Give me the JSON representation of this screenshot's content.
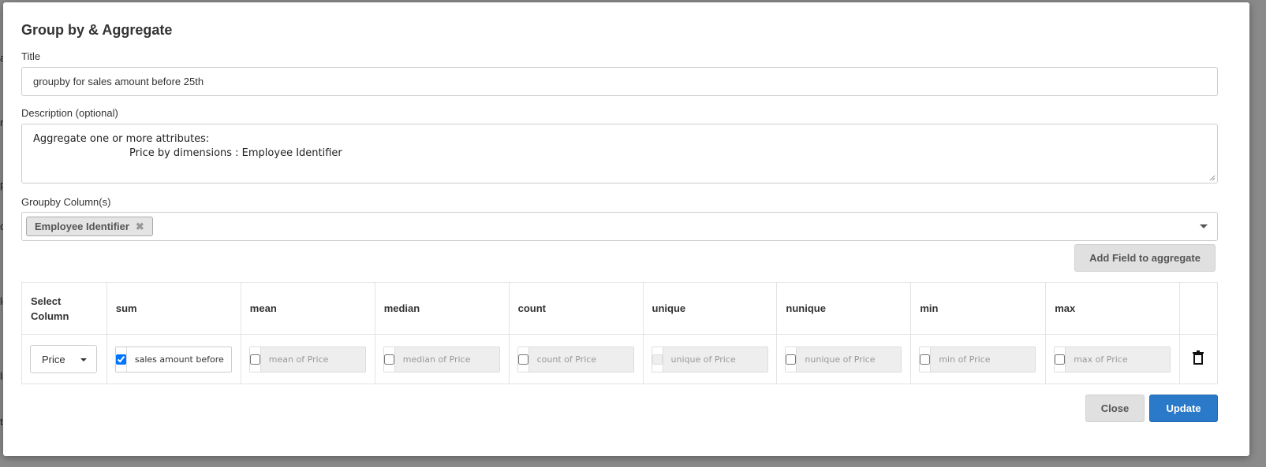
{
  "modal": {
    "title": "Group by & Aggregate",
    "title_label": "Title",
    "title_value": "groupby for sales amount before 25th",
    "description_label": "Description (optional)",
    "description_line1": "Aggregate one or more attributes:",
    "description_line2": "Price by dimensions : Employee Identifier",
    "groupby_label": "Groupby Column(s)",
    "groupby_chips": [
      "Employee Identifier"
    ],
    "add_field_label": "Add Field to aggregate",
    "close_label": "Close",
    "update_label": "Update"
  },
  "table": {
    "headers": [
      "Select Column",
      "sum",
      "mean",
      "median",
      "count",
      "unique",
      "nunique",
      "min",
      "max"
    ],
    "row": {
      "column": "Price",
      "sum": {
        "checked": true,
        "value": "sales amount before"
      },
      "mean": {
        "checked": false,
        "placeholder": "mean of Price"
      },
      "median": {
        "checked": false,
        "placeholder": "median of Price"
      },
      "count": {
        "checked": false,
        "placeholder": "count of Price"
      },
      "unique": {
        "checked": false,
        "disabled": true,
        "placeholder": "unique of Price"
      },
      "nunique": {
        "checked": false,
        "placeholder": "nunique of Price"
      },
      "min": {
        "checked": false,
        "placeholder": "min of Price"
      },
      "max": {
        "checked": false,
        "placeholder": "max of Price"
      }
    }
  },
  "icons": [
    "close-chip-icon",
    "dropdown-caret-icon",
    "trash-icon"
  ],
  "colors": {
    "primary": "#2a7ac9",
    "secondary": "#e0e0e0",
    "overlay": "#7f7f7f"
  }
}
